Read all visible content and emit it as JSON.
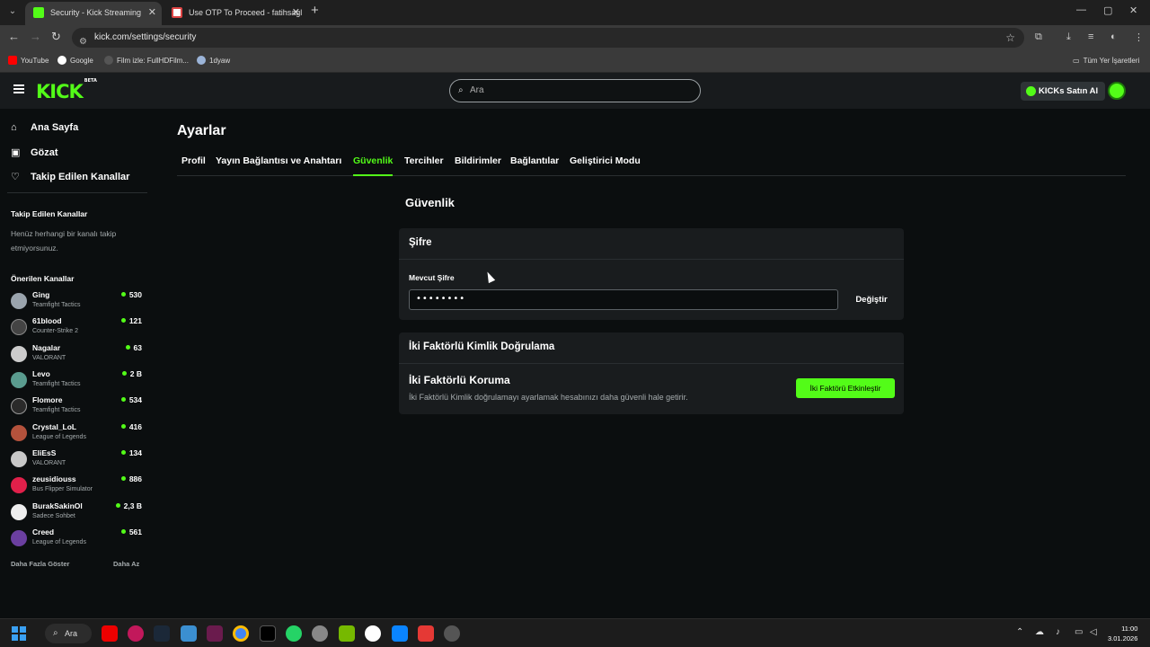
{
  "browser": {
    "tabs": [
      {
        "title": "Security - Kick Streaming",
        "active": true
      },
      {
        "title": "Use OTP To Proceed - fatihsagl",
        "active": false
      }
    ],
    "url": "kick.com/settings/security",
    "bookmarks": [
      "YouTube",
      "Google",
      "Film izle: FullHDFilm...",
      "1dyaw"
    ],
    "all_bookmarks": "Tüm Yer İşaretleri"
  },
  "header": {
    "logo": "KICK",
    "logo_badge": "BETA",
    "search_placeholder": "Ara",
    "buy_kicks": "KICKs Satın Al"
  },
  "sidebar": {
    "nav": [
      "Ana Sayfa",
      "Gözat",
      "Takip Edilen Kanallar"
    ],
    "followed_heading": "Takip Edilen Kanallar",
    "followed_empty": "Henüz herhangi bir kanalı takip etmiyorsunuz.",
    "recommended_heading": "Önerilen Kanallar",
    "channels": [
      {
        "name": "Ging",
        "game": "Teamfight Tactics",
        "viewers": "530"
      },
      {
        "name": "61blood",
        "game": "Counter-Strike 2",
        "viewers": "121"
      },
      {
        "name": "Nagalar",
        "game": "VALORANT",
        "viewers": "63"
      },
      {
        "name": "Levo",
        "game": "Teamfight Tactics",
        "viewers": "2 B"
      },
      {
        "name": "Flomore",
        "game": "Teamfight Tactics",
        "viewers": "534"
      },
      {
        "name": "Crystal_LoL",
        "game": "League of Legends",
        "viewers": "416"
      },
      {
        "name": "EliEsS",
        "game": "VALORANT",
        "viewers": "134"
      },
      {
        "name": "zeusidiouss",
        "game": "Bus Flipper Simulator",
        "viewers": "886"
      },
      {
        "name": "BurakSakinOl",
        "game": "Sadece Sohbet",
        "viewers": "2,3 B"
      },
      {
        "name": "Creed",
        "game": "League of Legends",
        "viewers": "561"
      }
    ],
    "show_more": "Daha Fazla Göster",
    "show_less": "Daha Az"
  },
  "main": {
    "title": "Ayarlar",
    "tabs": [
      "Profil",
      "Yayın Bağlantısı ve Anahtarı",
      "Güvenlik",
      "Tercihler",
      "Bildirimler",
      "Bağlantılar",
      "Geliştirici Modu"
    ],
    "active_tab": "Güvenlik",
    "section_title": "Güvenlik",
    "password": {
      "heading": "Şifre",
      "label": "Mevcut Şifre",
      "value": "••••••••",
      "change_button": "Değiştir"
    },
    "tfa": {
      "heading": "İki Faktörlü Kimlik Doğrulama",
      "title": "İki Faktörlü Koruma",
      "description": "İki Faktörlü Kimlik doğrulamayı ayarlamak hesabınızı daha güvenli hale getirir.",
      "button": "İki Faktörü Etkinleştir"
    }
  },
  "taskbar": {
    "search": "Ara",
    "time": "11:00",
    "date": "3.01.2026"
  },
  "colors": {
    "accent": "#53fc18",
    "background": "#0b0e0f",
    "card": "#191c1e"
  }
}
